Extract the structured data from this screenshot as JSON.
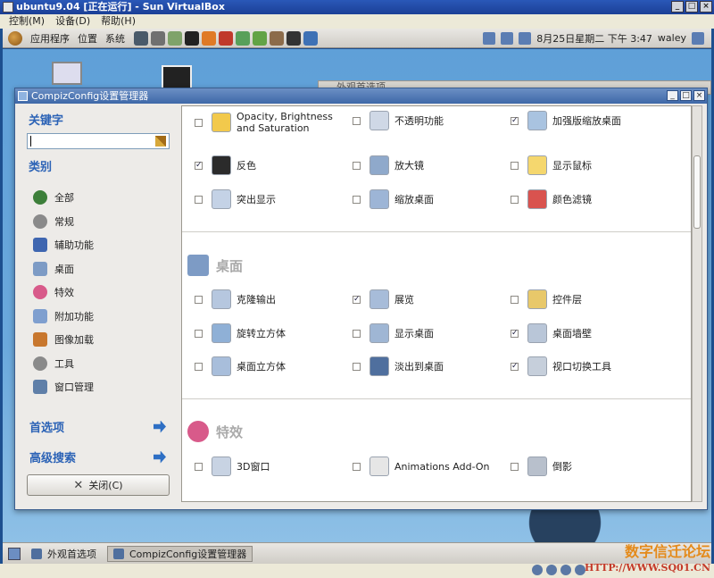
{
  "vbox": {
    "title": "ubuntu9.04 [正在运行] - Sun VirtualBox",
    "menu": [
      "控制(M)",
      "设备(D)",
      "帮助(H)"
    ]
  },
  "guest_panel": {
    "menus": [
      "应用程序",
      "位置",
      "系统"
    ],
    "clock": "8月25日星期二 下午 3:47",
    "user": "waley"
  },
  "background_window": {
    "title": "外观首选项"
  },
  "ccsm": {
    "title": "CompizConfig设置管理器",
    "sidebar": {
      "keyword_label": "关键字",
      "search_value": "",
      "category_label": "类别",
      "categories": [
        {
          "label": "全部",
          "icon": "globe-icon",
          "color": "#3d7f3a"
        },
        {
          "label": "常规",
          "icon": "gear-icon",
          "color": "#8a8a8a"
        },
        {
          "label": "辅助功能",
          "icon": "accessibility-icon",
          "color": "#3f66b0"
        },
        {
          "label": "桌面",
          "icon": "desktop-icon",
          "color": "#7d9bc5"
        },
        {
          "label": "特效",
          "icon": "effects-icon",
          "color": "#d85a8a"
        },
        {
          "label": "附加功能",
          "icon": "extras-icon",
          "color": "#7f9fcf"
        },
        {
          "label": "图像加载",
          "icon": "image-loading-icon",
          "color": "#c8772e"
        },
        {
          "label": "工具",
          "icon": "tools-icon",
          "color": "#8a8a8a"
        },
        {
          "label": "窗口管理",
          "icon": "window-management-icon",
          "color": "#5f7fa8"
        }
      ],
      "preferences_label": "首选项",
      "advanced_search_label": "高级搜索",
      "close_label": "关闭(C)"
    },
    "sections": [
      {
        "title": "",
        "plugins": [
          {
            "label": "Opacity, Brightness and Saturation",
            "checked": false,
            "icon": "opacity-icon",
            "color": "#f2c94c"
          },
          {
            "label": "不透明功能",
            "checked": false,
            "icon": "opacity-window-icon",
            "color": "#cfd8e6"
          },
          {
            "label": "加强版缩放桌面",
            "checked": true,
            "icon": "enhanced-zoom-icon",
            "color": "#a9c3e0"
          },
          {
            "label": "反色",
            "checked": true,
            "icon": "negative-icon",
            "color": "#2b2b2b"
          },
          {
            "label": "放大镜",
            "checked": false,
            "icon": "magnifier-icon",
            "color": "#8fa9cb"
          },
          {
            "label": "显示鼠标",
            "checked": false,
            "icon": "show-mouse-icon",
            "color": "#f5d76e"
          },
          {
            "label": "突出显示",
            "checked": false,
            "icon": "highlight-icon",
            "color": "#c4d2e6"
          },
          {
            "label": "缩放桌面",
            "checked": false,
            "icon": "zoom-desktop-icon",
            "color": "#9db5d6"
          },
          {
            "label": "颜色滤镜",
            "checked": false,
            "icon": "color-filter-icon",
            "color": "#d9534f"
          }
        ]
      },
      {
        "title": "桌面",
        "plugins": [
          {
            "label": "克隆输出",
            "checked": false,
            "icon": "clone-output-icon",
            "color": "#b6c7df"
          },
          {
            "label": "展览",
            "checked": true,
            "icon": "expo-icon",
            "color": "#a7bcd9"
          },
          {
            "label": "控件层",
            "checked": false,
            "icon": "widget-layer-icon",
            "color": "#e8c86a"
          },
          {
            "label": "旋转立方体",
            "checked": false,
            "icon": "rotate-cube-icon",
            "color": "#8fb0d6"
          },
          {
            "label": "显示桌面",
            "checked": false,
            "icon": "show-desktop-icon",
            "color": "#9fb6d4"
          },
          {
            "label": "桌面墙壁",
            "checked": true,
            "icon": "desktop-wall-icon",
            "color": "#b9c6d8"
          },
          {
            "label": "桌面立方体",
            "checked": false,
            "icon": "desktop-cube-icon",
            "color": "#a8bedb"
          },
          {
            "label": "淡出到桌面",
            "checked": false,
            "icon": "fade-desktop-icon",
            "color": "#4f6f9e"
          },
          {
            "label": "视口切换工具",
            "checked": true,
            "icon": "viewport-switcher-icon",
            "color": "#c6cfdb"
          }
        ]
      },
      {
        "title": "特效",
        "plugins": [
          {
            "label": "3D窗口",
            "checked": false,
            "icon": "3d-windows-icon",
            "color": "#c8d3e3"
          },
          {
            "label": "Animations Add-On",
            "checked": false,
            "icon": "animations-addon-icon",
            "color": "#e6e6e6"
          },
          {
            "label": "倒影",
            "checked": false,
            "icon": "reflection-icon",
            "color": "#b8c0cc"
          }
        ]
      }
    ]
  },
  "taskbar": {
    "tasks": [
      "外观首选项",
      "CompizConfig设置管理器"
    ]
  },
  "watermark": {
    "text": "数字信迁论坛",
    "url": "HTTP://WWW.SQ01.CN"
  }
}
